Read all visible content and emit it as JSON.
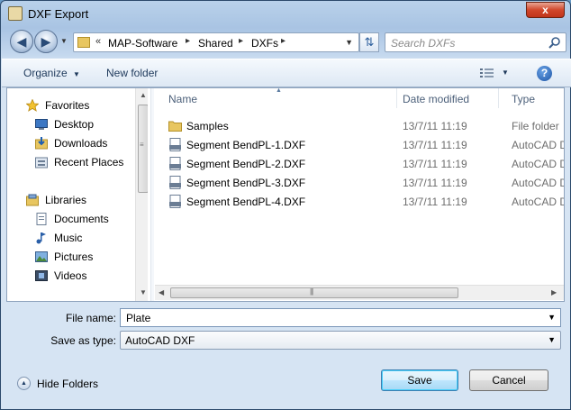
{
  "window": {
    "title": "DXF Export",
    "close_glyph": "x"
  },
  "navigation": {
    "back_glyph": "◀",
    "forward_glyph": "▶",
    "address_prefix": "«",
    "breadcrumbs": [
      "MAP-Software",
      "Shared",
      "DXFs"
    ],
    "search_placeholder": "Search DXFs"
  },
  "toolbar": {
    "organize_label": "Organize",
    "new_folder_label": "New folder",
    "help_glyph": "?"
  },
  "sidebar": {
    "favorites": {
      "label": "Favorites",
      "items": [
        {
          "label": "Desktop",
          "icon": "desktop-icon"
        },
        {
          "label": "Downloads",
          "icon": "downloads-icon"
        },
        {
          "label": "Recent Places",
          "icon": "recent-places-icon"
        }
      ]
    },
    "libraries": {
      "label": "Libraries",
      "items": [
        {
          "label": "Documents",
          "icon": "documents-icon"
        },
        {
          "label": "Music",
          "icon": "music-icon"
        },
        {
          "label": "Pictures",
          "icon": "pictures-icon"
        },
        {
          "label": "Videos",
          "icon": "videos-icon"
        }
      ]
    }
  },
  "file_list": {
    "columns": [
      "Name",
      "Date modified",
      "Type"
    ],
    "rows": [
      {
        "name": "Samples",
        "date": "13/7/11 11:19",
        "type": "File folder",
        "icon": "folder-icon"
      },
      {
        "name": "Segment BendPL-1.DXF",
        "date": "13/7/11 11:19",
        "type": "AutoCAD D",
        "icon": "dxf-file-icon"
      },
      {
        "name": "Segment BendPL-2.DXF",
        "date": "13/7/11 11:19",
        "type": "AutoCAD D",
        "icon": "dxf-file-icon"
      },
      {
        "name": "Segment BendPL-3.DXF",
        "date": "13/7/11 11:19",
        "type": "AutoCAD D",
        "icon": "dxf-file-icon"
      },
      {
        "name": "Segment BendPL-4.DXF",
        "date": "13/7/11 11:19",
        "type": "AutoCAD D",
        "icon": "dxf-file-icon"
      }
    ]
  },
  "form": {
    "file_name_label": "File name:",
    "file_name_value": "Plate",
    "save_as_label": "Save as type:",
    "save_as_value": "AutoCAD DXF"
  },
  "footer": {
    "hide_folders_label": "Hide Folders",
    "save_label": "Save",
    "cancel_label": "Cancel"
  },
  "colors": {
    "accent": "#3c7fb1",
    "folder": "#e8c660",
    "secondary_text": "#6d6d6d"
  }
}
